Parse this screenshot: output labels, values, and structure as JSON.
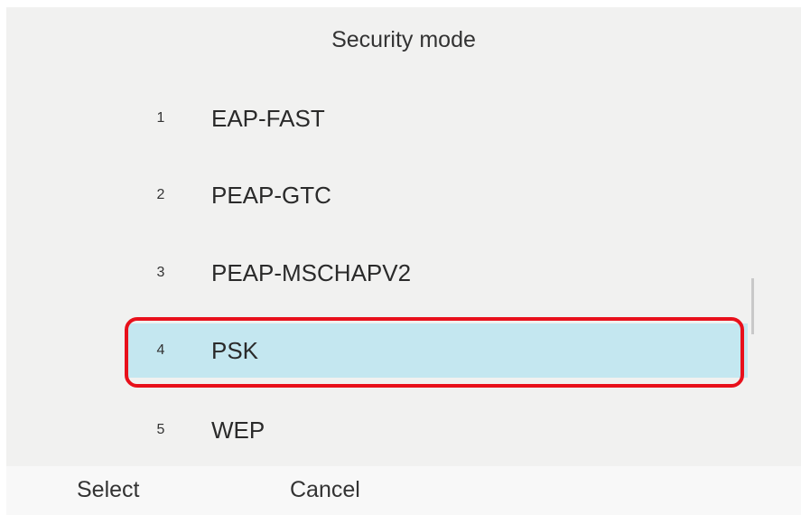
{
  "header": {
    "title": "Security mode"
  },
  "options": [
    {
      "number": "1",
      "label": "EAP-FAST"
    },
    {
      "number": "2",
      "label": "PEAP-GTC"
    },
    {
      "number": "3",
      "label": "PEAP-MSCHAPV2"
    },
    {
      "number": "4",
      "label": "PSK"
    },
    {
      "number": "5",
      "label": "WEP"
    }
  ],
  "selected_index": 3,
  "softkeys": {
    "select": "Select",
    "cancel": "Cancel"
  },
  "colors": {
    "selection": "#c4e7f0",
    "highlight_border": "#e8101b"
  }
}
